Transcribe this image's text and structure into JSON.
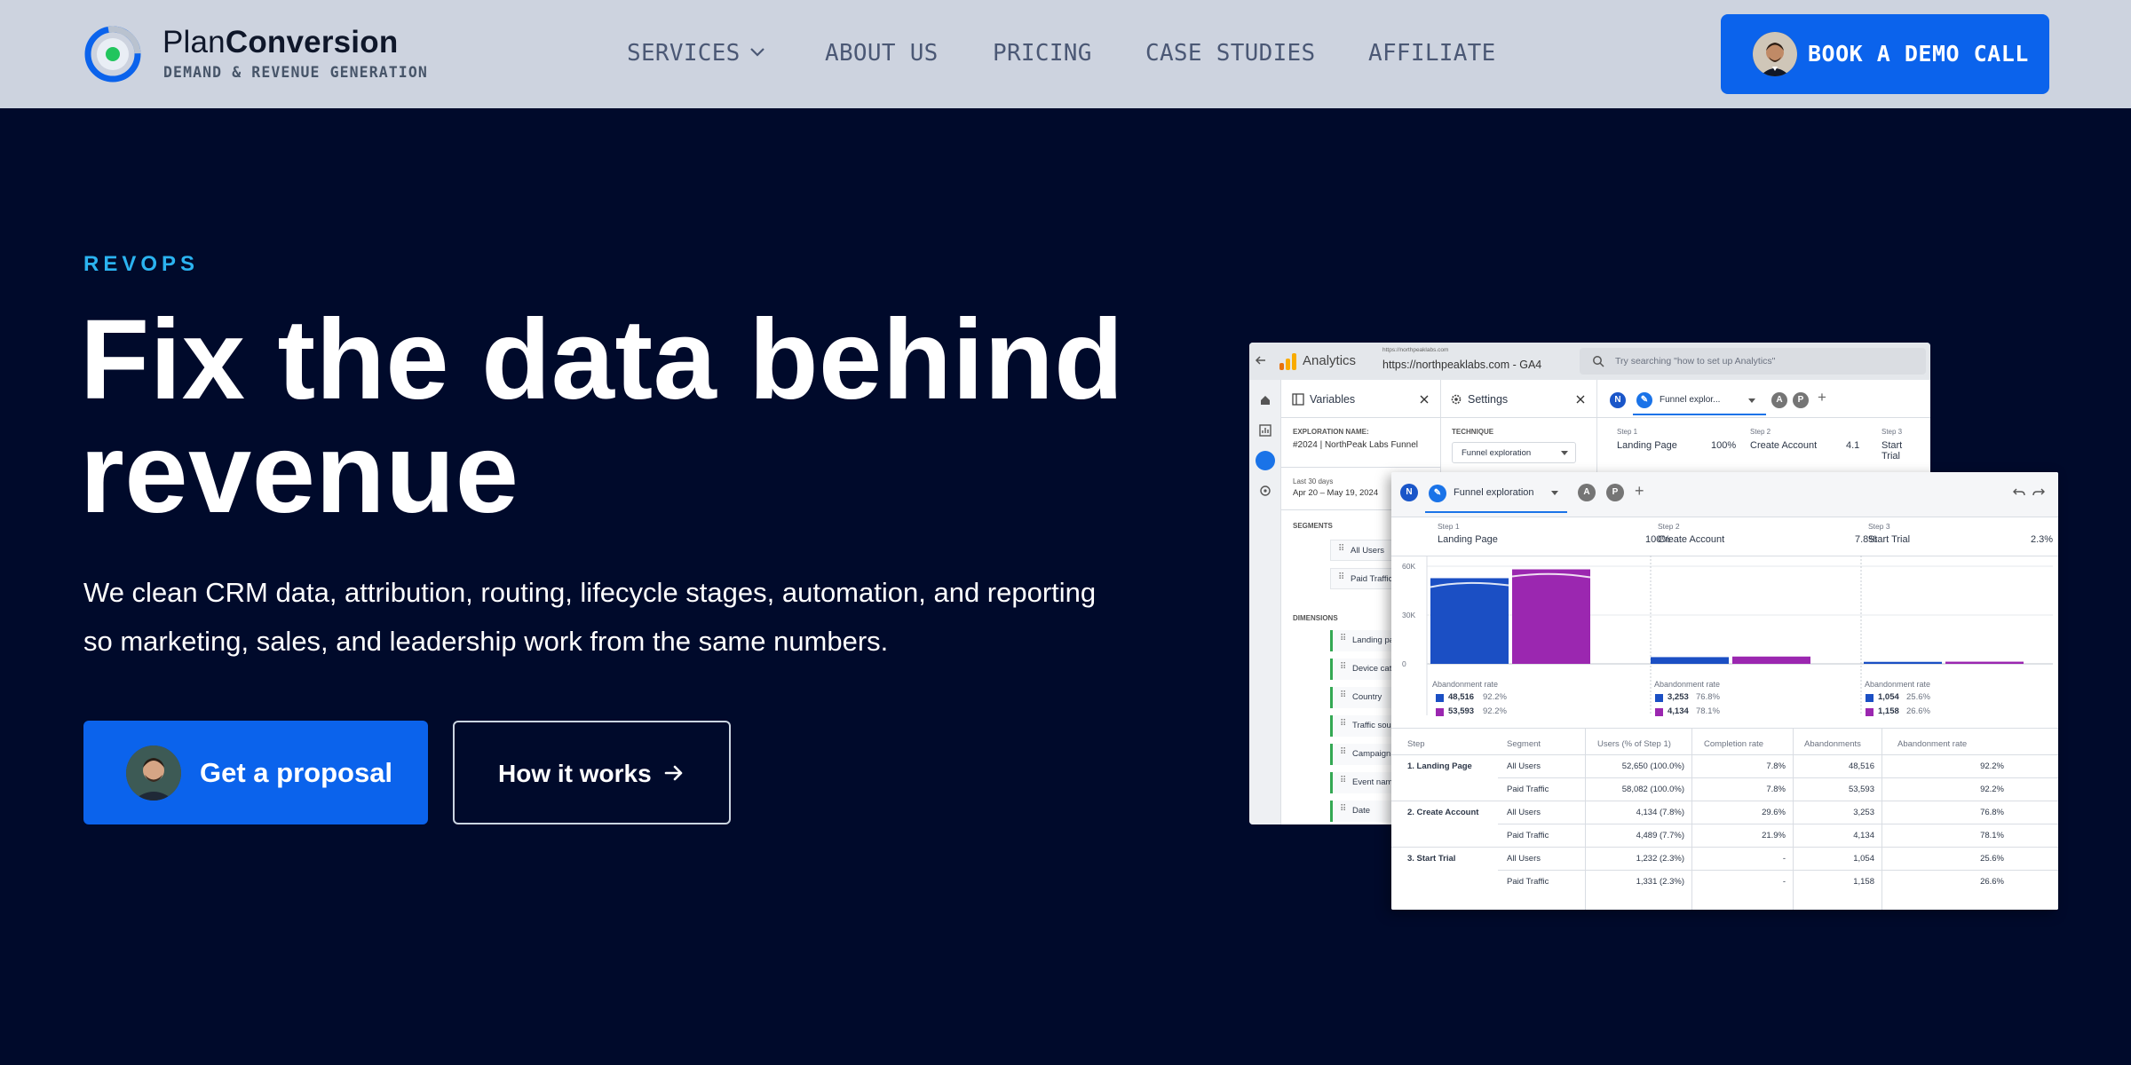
{
  "header": {
    "brand_light": "Plan",
    "brand_bold": "Conversion",
    "tagline": "DEMAND & REVENUE GENERATION",
    "nav": [
      {
        "label": "SERVICES",
        "has_dropdown": true
      },
      {
        "label": "ABOUT US"
      },
      {
        "label": "PRICING"
      },
      {
        "label": "CASE STUDIES"
      },
      {
        "label": "AFFILIATE"
      }
    ],
    "cta_label": "BOOK A DEMO CALL"
  },
  "hero": {
    "eyebrow": "REVOPS",
    "headline_line1": "Fix the data behind",
    "headline_line2": "revenue",
    "subtext_line1": "We clean CRM data, attribution, routing, lifecycle stages, automation, and reporting",
    "subtext_line2": "so marketing, sales, and leadership work from the same numbers.",
    "primary_button": "Get a proposal",
    "secondary_button": "How it works"
  },
  "colors": {
    "background": "#000a2b",
    "header_bg": "#cdd3df",
    "accent_blue": "#0b63ec",
    "eyebrow": "#2bb3f0",
    "series_all_users": "#1b4fc4",
    "series_paid_traffic": "#9b27b0"
  },
  "analytics_back": {
    "app_name": "Analytics",
    "url_small": "https://northpeaklabs.com",
    "url_large": "https://northpeaklabs.com - GA4",
    "search_placeholder": "Try searching \"how to set up Analytics\"",
    "variables_title": "Variables",
    "settings_title": "Settings",
    "exploration_name_label": "EXPLORATION NAME:",
    "exploration_name": "#2024 | NorthPeak Labs Funnel",
    "technique_label": "TECHNIQUE",
    "technique_value": "Funnel exploration",
    "date_label": "Last 30 days",
    "date_range": "Apr 20 – May 19, 2024",
    "segments_label": "SEGMENTS",
    "segments": [
      "All Users",
      "Paid Traffic"
    ],
    "dimensions_label": "DIMENSIONS",
    "dimensions": [
      "Landing page",
      "Device category",
      "Country",
      "Traffic source",
      "Campaign",
      "Event name",
      "Date"
    ],
    "tab_label": "Funnel explor...",
    "avatars": [
      "N",
      "A",
      "P"
    ],
    "steps": [
      {
        "step": "Step 1",
        "name": "Landing Page",
        "pct": "100%"
      },
      {
        "step": "Step 2",
        "name": "Create Account",
        "pct": "4.1"
      },
      {
        "step": "Step 3",
        "name": "Start Trial",
        "pct": ""
      }
    ]
  },
  "analytics_front": {
    "tab_label": "Funnel exploration",
    "avatars": [
      "N",
      "A",
      "P"
    ],
    "steps": [
      {
        "step": "Step 1",
        "name": "Landing Page",
        "pct": "100%"
      },
      {
        "step": "Step 2",
        "name": "Create Account",
        "pct": "7.8%"
      },
      {
        "step": "Step 3",
        "name": "Start Trial",
        "pct": "2.3%"
      }
    ],
    "abandonment_label": "Abandonment rate",
    "abandonment": [
      {
        "a_val": "48,516",
        "a_pct": "92.2%",
        "b_val": "53,593",
        "b_pct": "92.2%"
      },
      {
        "a_val": "3,253",
        "a_pct": "76.8%",
        "b_val": "4,134",
        "b_pct": "78.1%"
      },
      {
        "a_val": "1,054",
        "a_pct": "25.6%",
        "b_val": "1,158",
        "b_pct": "26.6%"
      }
    ],
    "table": {
      "headers": [
        "Step",
        "Segment",
        "Users (% of Step 1)",
        "Completion rate",
        "Abandonments",
        "Abandonment rate"
      ],
      "rows": [
        {
          "step": "1. Landing Page",
          "segment": "All Users",
          "users": "52,650 (100.0%)",
          "completion": "7.8%",
          "abandonments": "48,516",
          "rate": "92.2%"
        },
        {
          "step": "",
          "segment": "Paid Traffic",
          "users": "58,082 (100.0%)",
          "completion": "7.8%",
          "abandonments": "53,593",
          "rate": "92.2%"
        },
        {
          "step": "2. Create Account",
          "segment": "All Users",
          "users": "4,134 (7.8%)",
          "completion": "29.6%",
          "abandonments": "3,253",
          "rate": "76.8%"
        },
        {
          "step": "",
          "segment": "Paid Traffic",
          "users": "4,489 (7.7%)",
          "completion": "21.9%",
          "abandonments": "4,134",
          "rate": "78.1%"
        },
        {
          "step": "3. Start Trial",
          "segment": "All Users",
          "users": "1,232 (2.3%)",
          "completion": "-",
          "abandonments": "1,054",
          "rate": "25.6%"
        },
        {
          "step": "",
          "segment": "Paid Traffic",
          "users": "1,331 (2.3%)",
          "completion": "-",
          "abandonments": "1,158",
          "rate": "26.6%"
        }
      ]
    }
  },
  "chart_data": {
    "type": "bar",
    "categories": [
      "Step 1",
      "Step 2",
      "Step 3"
    ],
    "series": [
      {
        "name": "All Users",
        "values": [
          52650,
          4134,
          1232
        ]
      },
      {
        "name": "Paid Traffic",
        "values": [
          58082,
          4489,
          1331
        ]
      }
    ],
    "y_ticks": [
      "60K",
      "30K",
      "0"
    ],
    "ylim": [
      0,
      60000
    ]
  }
}
